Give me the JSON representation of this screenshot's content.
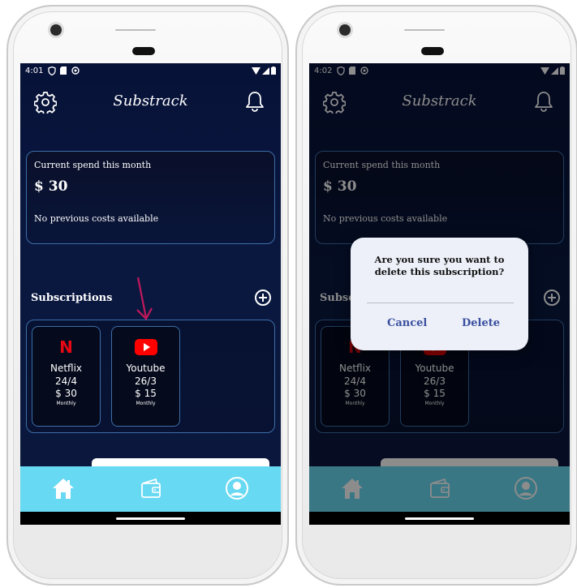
{
  "left_screen": {
    "status": {
      "time": "4:01"
    },
    "app_title": "Substrack",
    "spend_card": {
      "label": "Current spend this month",
      "amount": "$ 30",
      "previous": "No previous costs available"
    },
    "subscriptions_title": "Subscriptions",
    "subscriptions": [
      {
        "name": "Netflix",
        "date": "24/4",
        "price": "$ 30",
        "frequency": "Monthly",
        "icon": "netflix-icon"
      },
      {
        "name": "Youtube",
        "date": "26/3",
        "price": "$ 15",
        "frequency": "Monthly",
        "icon": "youtube-icon"
      }
    ],
    "nav": [
      "home-icon",
      "wallet-icon",
      "profile-icon"
    ]
  },
  "right_screen": {
    "status": {
      "time": "4:02"
    },
    "app_title": "Substrack",
    "spend_card": {
      "label": "Current spend this month",
      "amount": "$ 30",
      "previous": "No previous costs available"
    },
    "subscriptions_title": "Subscriptions",
    "subscriptions": [
      {
        "name": "Netflix",
        "date": "24/4",
        "price": "$ 30",
        "frequency": "Monthly"
      },
      {
        "name": "Youtube",
        "date": "26/3",
        "price": "$ 15",
        "frequency": "Monthly"
      }
    ],
    "dialog": {
      "message": "Are you sure you want to delete this subscription?",
      "cancel": "Cancel",
      "delete": "Delete"
    }
  },
  "colors": {
    "background": "#0a1840",
    "navbar": "#68d9f2",
    "card_border": "#3d6ea8",
    "arrow": "#c2185b",
    "dialog_button": "#3a4fa0"
  }
}
